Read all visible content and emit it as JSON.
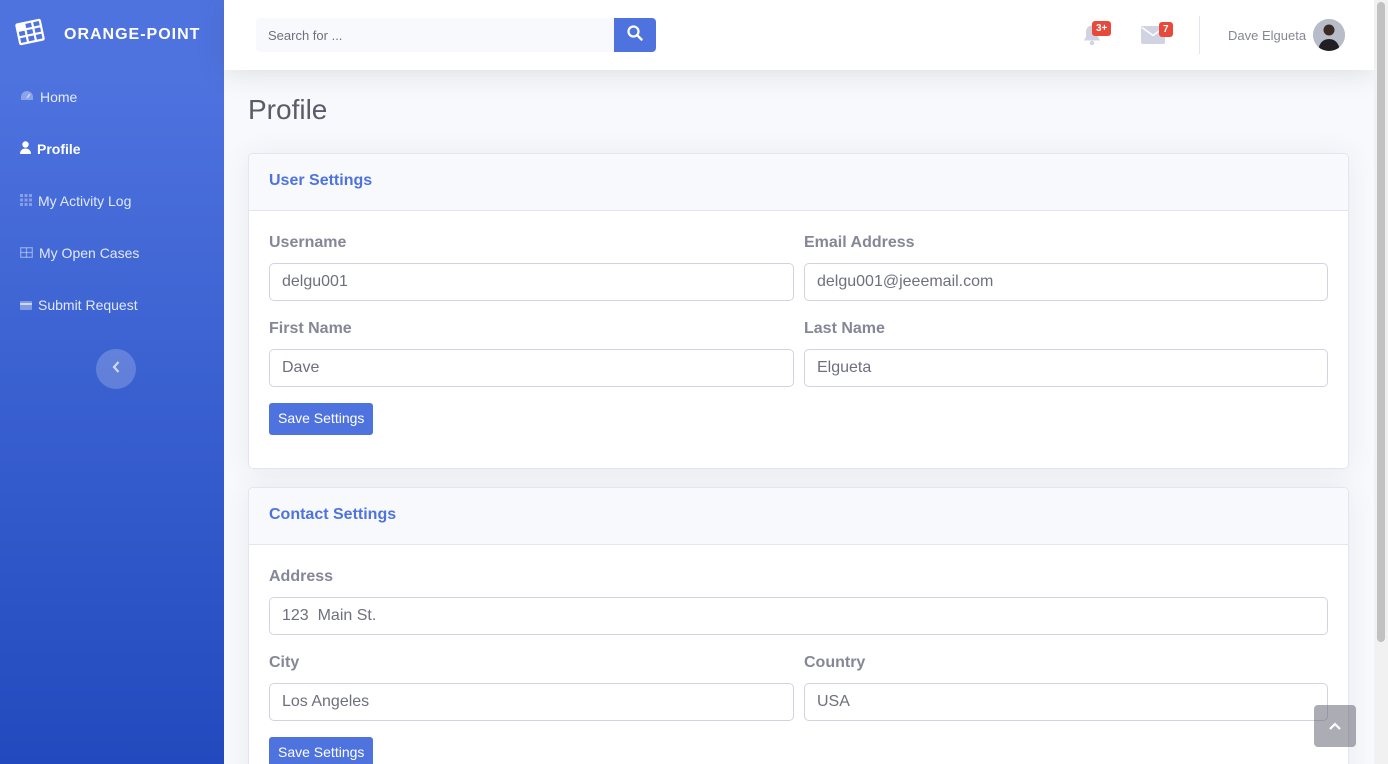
{
  "brand": {
    "name": "ORANGE-POINT",
    "icon": "grid-table-icon"
  },
  "sidebar": {
    "items": [
      {
        "label": "Home",
        "icon": "tachometer-icon"
      },
      {
        "label": "Profile",
        "icon": "user-icon",
        "active": true
      },
      {
        "label": "My Activity Log",
        "icon": "grid-icon"
      },
      {
        "label": "My Open Cases",
        "icon": "table-icon"
      },
      {
        "label": "Submit Request",
        "icon": "card-icon"
      }
    ],
    "toggle_icon": "chevron-left-icon"
  },
  "topbar": {
    "search": {
      "placeholder": "Search for ...",
      "value": ""
    },
    "alerts": {
      "badge": "3+",
      "icon": "bell-icon"
    },
    "messages": {
      "badge": "7",
      "icon": "envelope-icon"
    },
    "user": {
      "name": "Dave Elgueta"
    }
  },
  "page": {
    "title": "Profile"
  },
  "user_settings": {
    "header": "User Settings",
    "username": {
      "label": "Username",
      "value": "delgu001"
    },
    "email": {
      "label": "Email Address",
      "value": "delgu001@jeeemail.com"
    },
    "first_name": {
      "label": "First Name",
      "value": "Dave"
    },
    "last_name": {
      "label": "Last Name",
      "value": "Elgueta"
    },
    "save_label": "Save Settings"
  },
  "contact_settings": {
    "header": "Contact Settings",
    "address": {
      "label": "Address",
      "value": "123  Main St."
    },
    "city": {
      "label": "City",
      "value": "Los Angeles"
    },
    "country": {
      "label": "Country",
      "value": "USA"
    },
    "save_label": "Save Settings"
  },
  "colors": {
    "primary": "#4e73df",
    "sidebar_end": "#224abe",
    "badge": "#e74a3b"
  }
}
